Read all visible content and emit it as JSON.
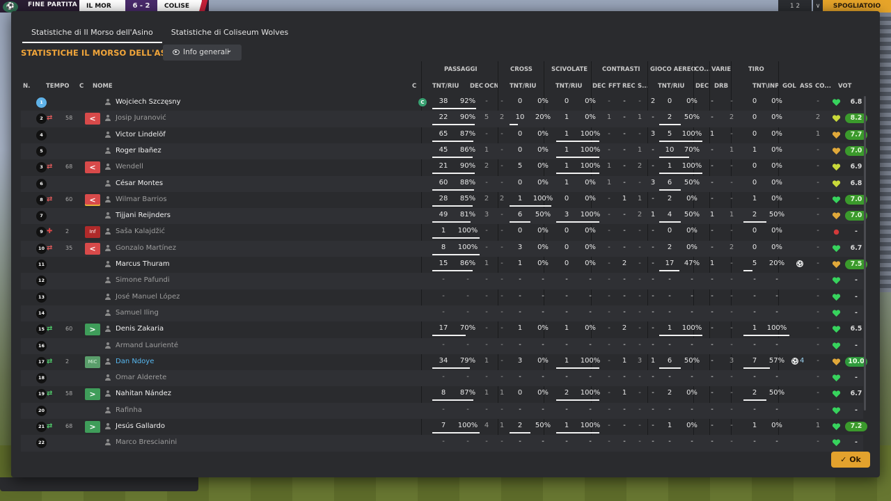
{
  "topbar": {
    "event": "FINE PARTITA",
    "team1": "IL MOR",
    "score": "6 - 2",
    "team2": "COLISE",
    "right_a": "1  2",
    "right_b": "∨",
    "right_c": "SPOGLIATOIO"
  },
  "tabs": [
    "Statistiche di Il Morso dell'Asino",
    "Statistiche di Coliseum Wolves"
  ],
  "section_title": "STATISTICHE IL MORSO DELL'ASINO",
  "dropdown_label": "Info generali",
  "groups": {
    "passaggi": "PASSAGGI",
    "cross": "CROSS",
    "scivolate": "SCIVOLATE",
    "contrasti": "CONTRASTI",
    "gioco_aereo": "GIOCO AEREO",
    "co": "CO...",
    "varie": "VARIE",
    "tiro": "TIRO"
  },
  "columns": {
    "n": "N.",
    "tempo": "TEMPO",
    "c": "C",
    "nome": "NOME",
    "c2": "C",
    "tnt_riu": "TNT/RIU",
    "dec": "DEC",
    "ocn": "OCN",
    "cross_tr": "TNT/RIU",
    "sciv_tr": "TNT/RIU",
    "con_dec": "DEC",
    "fft": "FFT",
    "rec": "REC",
    "s": "S...",
    "aereo_tr": "TNT/RIU",
    "co_dec": "DEC",
    "drb": "DRB",
    "tnt_inp": "TNT\\INP",
    "gol": "GOL",
    "ass": "ASS",
    "co2": "CO...",
    "vot": "VOT"
  },
  "rows": [
    {
      "n": "1",
      "gk": true,
      "min": "",
      "sub": "",
      "cbox": "",
      "cbox_label": "",
      "name": "Wojciech Szczęsny",
      "cap": "C",
      "dim": false,
      "blue": false,
      "pt": "38",
      "pp": "92%",
      "pbar": 0.92,
      "pdec": "-",
      "pocn": "-",
      "ct": "0",
      "cp": "0%",
      "cbar": 0,
      "st": "0",
      "sp": "0%",
      "sbar": 0,
      "kdec": "-",
      "kfft": "-",
      "krec": "-",
      "ks": "2",
      "at": "0",
      "ap": "0%",
      "abar": 0,
      "codec": "-",
      "drb": "-",
      "tt": "0",
      "tp": "0%",
      "tbar": 0,
      "gol": "",
      "ass": "-",
      "heart": "green",
      "vot": "6.8",
      "vcls": ""
    },
    {
      "n": "2",
      "gk": false,
      "min": "58",
      "sub": "out",
      "cbox": "out",
      "cbox_label": "<",
      "name": "Josip Juranović",
      "cap": "",
      "dim": true,
      "blue": false,
      "pt": "22",
      "pp": "90%",
      "pbar": 0.9,
      "pdec": "5",
      "pocn": "2",
      "ct": "10",
      "cp": "20%",
      "cbar": 0.2,
      "st": "1",
      "sp": "0%",
      "sbar": 0,
      "kdec": "1",
      "kfft": "-",
      "krec": "1",
      "ks": "-",
      "at": "2",
      "ap": "50%",
      "abar": 0.5,
      "codec": "-",
      "drb": "2",
      "tt": "0",
      "tp": "0%",
      "tbar": 0,
      "gol": "",
      "ass": "2",
      "heart": "yellow",
      "vot": "8.2",
      "vcls": "g1"
    },
    {
      "n": "4",
      "gk": false,
      "min": "",
      "sub": "",
      "cbox": "",
      "cbox_label": "",
      "name": "Victor Lindelöf",
      "cap": "",
      "dim": false,
      "blue": false,
      "pt": "65",
      "pp": "87%",
      "pbar": 0.87,
      "pdec": "-",
      "pocn": "-",
      "ct": "0",
      "cp": "0%",
      "cbar": 0,
      "st": "1",
      "sp": "100%",
      "sbar": 1,
      "kdec": "-",
      "kfft": "-",
      "krec": "-",
      "ks": "3",
      "at": "5",
      "ap": "100%",
      "abar": 1,
      "codec": "1",
      "drb": "-",
      "tt": "0",
      "tp": "0%",
      "tbar": 0,
      "gol": "",
      "ass": "1",
      "heart": "orange",
      "vot": "7.7",
      "vcls": "g1"
    },
    {
      "n": "5",
      "gk": false,
      "min": "",
      "sub": "",
      "cbox": "",
      "cbox_label": "",
      "name": "Roger Ibañez",
      "cap": "",
      "dim": false,
      "blue": false,
      "pt": "45",
      "pp": "86%",
      "pbar": 0.86,
      "pdec": "1",
      "pocn": "-",
      "ct": "0",
      "cp": "0%",
      "cbar": 0,
      "st": "1",
      "sp": "100%",
      "sbar": 1,
      "kdec": "-",
      "kfft": "-",
      "krec": "1",
      "ks": "-",
      "at": "10",
      "ap": "70%",
      "abar": 0.7,
      "codec": "-",
      "drb": "1",
      "tt": "1",
      "tp": "0%",
      "tbar": 0,
      "gol": "",
      "ass": "-",
      "heart": "orange",
      "vot": "7.0",
      "vcls": "g1"
    },
    {
      "n": "3",
      "gk": false,
      "min": "68",
      "sub": "out",
      "cbox": "out",
      "cbox_label": "<",
      "name": "Wendell",
      "cap": "",
      "dim": true,
      "blue": false,
      "pt": "21",
      "pp": "90%",
      "pbar": 0.9,
      "pdec": "2",
      "pocn": "-",
      "ct": "5",
      "cp": "0%",
      "cbar": 0,
      "st": "1",
      "sp": "100%",
      "sbar": 1,
      "kdec": "1",
      "kfft": "-",
      "krec": "2",
      "ks": "-",
      "at": "1",
      "ap": "100%",
      "abar": 1,
      "codec": "-",
      "drb": "-",
      "tt": "0",
      "tp": "0%",
      "tbar": 0,
      "gol": "",
      "ass": "-",
      "heart": "yellow",
      "vot": "6.9",
      "vcls": ""
    },
    {
      "n": "6",
      "gk": false,
      "min": "",
      "sub": "",
      "cbox": "",
      "cbox_label": "",
      "name": "César Montes",
      "cap": "",
      "dim": false,
      "blue": false,
      "pt": "60",
      "pp": "88%",
      "pbar": 0.88,
      "pdec": "-",
      "pocn": "-",
      "ct": "0",
      "cp": "0%",
      "cbar": 0,
      "st": "1",
      "sp": "0%",
      "sbar": 0,
      "kdec": "1",
      "kfft": "-",
      "krec": "-",
      "ks": "3",
      "at": "6",
      "ap": "50%",
      "abar": 0.5,
      "codec": "-",
      "drb": "-",
      "tt": "0",
      "tp": "0%",
      "tbar": 0,
      "gol": "",
      "ass": "-",
      "heart": "yellow",
      "vot": "6.8",
      "vcls": ""
    },
    {
      "n": "8",
      "gk": false,
      "min": "60",
      "sub": "out",
      "cbox": "outy",
      "cbox_label": "<",
      "name": "Wilmar Barrios",
      "cap": "",
      "dim": true,
      "blue": false,
      "pt": "28",
      "pp": "85%",
      "pbar": 0.85,
      "pdec": "2",
      "pocn": "2",
      "ct": "1",
      "cp": "100%",
      "cbar": 1,
      "st": "0",
      "sp": "0%",
      "sbar": 0,
      "kdec": "-",
      "kfft": "1",
      "krec": "1",
      "ks": "-",
      "at": "2",
      "ap": "0%",
      "abar": 0,
      "codec": "-",
      "drb": "-",
      "tt": "1",
      "tp": "0%",
      "tbar": 0,
      "gol": "",
      "ass": "-",
      "heart": "green",
      "vot": "7.0",
      "vcls": "g1"
    },
    {
      "n": "7",
      "gk": false,
      "min": "",
      "sub": "",
      "cbox": "",
      "cbox_label": "",
      "name": "Tijjani Reijnders",
      "cap": "",
      "dim": false,
      "blue": false,
      "pt": "49",
      "pp": "81%",
      "pbar": 0.81,
      "pdec": "3",
      "pocn": "-",
      "ct": "6",
      "cp": "50%",
      "cbar": 0.5,
      "st": "3",
      "sp": "100%",
      "sbar": 1,
      "kdec": "-",
      "kfft": "-",
      "krec": "2",
      "ks": "1",
      "at": "4",
      "ap": "50%",
      "abar": 0.5,
      "codec": "1",
      "drb": "1",
      "tt": "2",
      "tp": "50%",
      "tbar": 0.5,
      "gol": "",
      "ass": "-",
      "heart": "orange",
      "vot": "7.0",
      "vcls": "g1"
    },
    {
      "n": "9",
      "gk": false,
      "min": "2",
      "sub": "inj",
      "cbox": "inj",
      "cbox_label": "Inf",
      "name": "Saša Kalajdžić",
      "cap": "",
      "dim": true,
      "blue": false,
      "pt": "1",
      "pp": "100%",
      "pbar": 1,
      "pdec": "-",
      "pocn": "-",
      "ct": "0",
      "cp": "0%",
      "cbar": 0,
      "st": "0",
      "sp": "0%",
      "sbar": 0,
      "kdec": "-",
      "kfft": "-",
      "krec": "-",
      "ks": "-",
      "at": "0",
      "ap": "0%",
      "abar": 0,
      "codec": "-",
      "drb": "-",
      "tt": "0",
      "tp": "0%",
      "tbar": 0,
      "gol": "",
      "ass": "-",
      "heart": "red",
      "vot": "-",
      "vcls": ""
    },
    {
      "n": "10",
      "gk": false,
      "min": "35",
      "sub": "out",
      "cbox": "out",
      "cbox_label": "<",
      "name": "Gonzalo Martínez",
      "cap": "",
      "dim": true,
      "blue": false,
      "pt": "8",
      "pp": "100%",
      "pbar": 1,
      "pdec": "-",
      "pocn": "-",
      "ct": "3",
      "cp": "0%",
      "cbar": 0,
      "st": "0",
      "sp": "0%",
      "sbar": 0,
      "kdec": "-",
      "kfft": "-",
      "krec": "-",
      "ks": "-",
      "at": "2",
      "ap": "0%",
      "abar": 0,
      "codec": "-",
      "drb": "2",
      "tt": "0",
      "tp": "0%",
      "tbar": 0,
      "gol": "",
      "ass": "-",
      "heart": "green",
      "vot": "6.7",
      "vcls": ""
    },
    {
      "n": "11",
      "gk": false,
      "min": "",
      "sub": "",
      "cbox": "",
      "cbox_label": "",
      "name": "Marcus Thuram",
      "cap": "",
      "dim": false,
      "blue": false,
      "pt": "15",
      "pp": "86%",
      "pbar": 0.86,
      "pdec": "1",
      "pocn": "-",
      "ct": "1",
      "cp": "0%",
      "cbar": 0,
      "st": "0",
      "sp": "0%",
      "sbar": 0,
      "kdec": "-",
      "kfft": "2",
      "krec": "-",
      "ks": "-",
      "at": "17",
      "ap": "47%",
      "abar": 0.47,
      "codec": "1",
      "drb": "-",
      "tt": "5",
      "tp": "20%",
      "tbar": 0.2,
      "gol": "ball",
      "ass": "-",
      "heart": "orange",
      "vot": "7.5",
      "vcls": "g1"
    },
    {
      "n": "12",
      "gk": false,
      "min": "",
      "sub": "",
      "cbox": "",
      "cbox_label": "",
      "name": "Simone Pafundi",
      "cap": "",
      "dim": true,
      "blue": false,
      "pt": "-",
      "pp": "-",
      "pbar": 0,
      "pdec": "-",
      "pocn": "-",
      "ct": "-",
      "cp": "-",
      "cbar": 0,
      "st": "-",
      "sp": "-",
      "sbar": 0,
      "kdec": "-",
      "kfft": "-",
      "krec": "-",
      "ks": "-",
      "at": "-",
      "ap": "-",
      "abar": 0,
      "codec": "-",
      "drb": "-",
      "tt": "-",
      "tp": "-",
      "tbar": 0,
      "gol": "",
      "ass": "-",
      "heart": "green",
      "vot": "-",
      "vcls": ""
    },
    {
      "n": "13",
      "gk": false,
      "min": "",
      "sub": "",
      "cbox": "",
      "cbox_label": "",
      "name": "José Manuel López",
      "cap": "",
      "dim": true,
      "blue": false,
      "pt": "-",
      "pp": "-",
      "pbar": 0,
      "pdec": "-",
      "pocn": "-",
      "ct": "-",
      "cp": "-",
      "cbar": 0,
      "st": "-",
      "sp": "-",
      "sbar": 0,
      "kdec": "-",
      "kfft": "-",
      "krec": "-",
      "ks": "-",
      "at": "-",
      "ap": "-",
      "abar": 0,
      "codec": "-",
      "drb": "-",
      "tt": "-",
      "tp": "-",
      "tbar": 0,
      "gol": "",
      "ass": "-",
      "heart": "green",
      "vot": "-",
      "vcls": ""
    },
    {
      "n": "14",
      "gk": false,
      "min": "",
      "sub": "",
      "cbox": "",
      "cbox_label": "",
      "name": "Samuel Iling",
      "cap": "",
      "dim": true,
      "blue": false,
      "pt": "-",
      "pp": "-",
      "pbar": 0,
      "pdec": "-",
      "pocn": "-",
      "ct": "-",
      "cp": "-",
      "cbar": 0,
      "st": "-",
      "sp": "-",
      "sbar": 0,
      "kdec": "-",
      "kfft": "-",
      "krec": "-",
      "ks": "-",
      "at": "-",
      "ap": "-",
      "abar": 0,
      "codec": "-",
      "drb": "-",
      "tt": "-",
      "tp": "-",
      "tbar": 0,
      "gol": "",
      "ass": "-",
      "heart": "green",
      "vot": "-",
      "vcls": ""
    },
    {
      "n": "15",
      "gk": false,
      "min": "60",
      "sub": "in",
      "cbox": "in",
      "cbox_label": ">",
      "name": "Denis Zakaria",
      "cap": "",
      "dim": false,
      "blue": false,
      "pt": "17",
      "pp": "70%",
      "pbar": 0.7,
      "pdec": "-",
      "pocn": "-",
      "ct": "1",
      "cp": "0%",
      "cbar": 0,
      "st": "1",
      "sp": "0%",
      "sbar": 0,
      "kdec": "-",
      "kfft": "2",
      "krec": "-",
      "ks": "-",
      "at": "1",
      "ap": "100%",
      "abar": 1,
      "codec": "-",
      "drb": "-",
      "tt": "1",
      "tp": "100%",
      "tbar": 1,
      "gol": "",
      "ass": "-",
      "heart": "green",
      "vot": "6.5",
      "vcls": ""
    },
    {
      "n": "16",
      "gk": false,
      "min": "",
      "sub": "",
      "cbox": "",
      "cbox_label": "",
      "name": "Armand Laurienté",
      "cap": "",
      "dim": true,
      "blue": false,
      "pt": "-",
      "pp": "-",
      "pbar": 0,
      "pdec": "-",
      "pocn": "-",
      "ct": "-",
      "cp": "-",
      "cbar": 0,
      "st": "-",
      "sp": "-",
      "sbar": 0,
      "kdec": "-",
      "kfft": "-",
      "krec": "-",
      "ks": "-",
      "at": "-",
      "ap": "-",
      "abar": 0,
      "codec": "-",
      "drb": "-",
      "tt": "-",
      "tp": "-",
      "tbar": 0,
      "gol": "",
      "ass": "-",
      "heart": "green",
      "vot": "-",
      "vcls": ""
    },
    {
      "n": "17",
      "gk": false,
      "min": "2",
      "sub": "in",
      "cbox": "mic",
      "cbox_label": "MiC",
      "name": "Dan Ndoye",
      "cap": "",
      "dim": false,
      "blue": true,
      "pt": "34",
      "pp": "79%",
      "pbar": 0.79,
      "pdec": "1",
      "pocn": "-",
      "ct": "3",
      "cp": "0%",
      "cbar": 0,
      "st": "1",
      "sp": "100%",
      "sbar": 1,
      "kdec": "-",
      "kfft": "1",
      "krec": "3",
      "ks": "1",
      "at": "6",
      "ap": "50%",
      "abar": 0.5,
      "codec": "-",
      "drb": "3",
      "tt": "7",
      "tp": "57%",
      "tbar": 0.57,
      "gol": "ball4",
      "ass": "-",
      "heart": "orange",
      "vot": "10.0",
      "vcls": "g2"
    },
    {
      "n": "18",
      "gk": false,
      "min": "",
      "sub": "",
      "cbox": "",
      "cbox_label": "",
      "name": "Omar Alderete",
      "cap": "",
      "dim": true,
      "blue": false,
      "pt": "-",
      "pp": "-",
      "pbar": 0,
      "pdec": "-",
      "pocn": "-",
      "ct": "-",
      "cp": "-",
      "cbar": 0,
      "st": "-",
      "sp": "-",
      "sbar": 0,
      "kdec": "-",
      "kfft": "-",
      "krec": "-",
      "ks": "-",
      "at": "-",
      "ap": "-",
      "abar": 0,
      "codec": "-",
      "drb": "-",
      "tt": "-",
      "tp": "-",
      "tbar": 0,
      "gol": "",
      "ass": "-",
      "heart": "green",
      "vot": "-",
      "vcls": ""
    },
    {
      "n": "19",
      "gk": false,
      "min": "58",
      "sub": "in",
      "cbox": "in",
      "cbox_label": ">",
      "name": "Nahitan Nández",
      "cap": "",
      "dim": false,
      "blue": false,
      "pt": "8",
      "pp": "87%",
      "pbar": 0.87,
      "pdec": "1",
      "pocn": "1",
      "ct": "0",
      "cp": "0%",
      "cbar": 0,
      "st": "2",
      "sp": "100%",
      "sbar": 1,
      "kdec": "-",
      "kfft": "1",
      "krec": "-",
      "ks": "-",
      "at": "2",
      "ap": "0%",
      "abar": 0,
      "codec": "-",
      "drb": "-",
      "tt": "2",
      "tp": "50%",
      "tbar": 0.5,
      "gol": "",
      "ass": "-",
      "heart": "green",
      "vot": "6.7",
      "vcls": ""
    },
    {
      "n": "20",
      "gk": false,
      "min": "",
      "sub": "",
      "cbox": "",
      "cbox_label": "",
      "name": "Rafinha",
      "cap": "",
      "dim": true,
      "blue": false,
      "pt": "-",
      "pp": "-",
      "pbar": 0,
      "pdec": "-",
      "pocn": "-",
      "ct": "-",
      "cp": "-",
      "cbar": 0,
      "st": "-",
      "sp": "-",
      "sbar": 0,
      "kdec": "-",
      "kfft": "-",
      "krec": "-",
      "ks": "-",
      "at": "-",
      "ap": "-",
      "abar": 0,
      "codec": "-",
      "drb": "-",
      "tt": "-",
      "tp": "-",
      "tbar": 0,
      "gol": "",
      "ass": "-",
      "heart": "green",
      "vot": "-",
      "vcls": ""
    },
    {
      "n": "21",
      "gk": false,
      "min": "68",
      "sub": "in",
      "cbox": "in",
      "cbox_label": ">",
      "name": "Jesús Gallardo",
      "cap": "",
      "dim": false,
      "blue": false,
      "pt": "7",
      "pp": "100%",
      "pbar": 1,
      "pdec": "4",
      "pocn": "1",
      "ct": "2",
      "cp": "50%",
      "cbar": 0.5,
      "st": "1",
      "sp": "100%",
      "sbar": 1,
      "kdec": "-",
      "kfft": "-",
      "krec": "-",
      "ks": "-",
      "at": "1",
      "ap": "0%",
      "abar": 0,
      "codec": "-",
      "drb": "-",
      "tt": "1",
      "tp": "0%",
      "tbar": 0,
      "gol": "",
      "ass": "1",
      "heart": "green",
      "vot": "7.2",
      "vcls": "g1"
    },
    {
      "n": "22",
      "gk": false,
      "min": "",
      "sub": "",
      "cbox": "",
      "cbox_label": "",
      "name": "Marco Brescianini",
      "cap": "",
      "dim": true,
      "blue": false,
      "pt": "-",
      "pp": "-",
      "pbar": 0,
      "pdec": "-",
      "pocn": "-",
      "ct": "-",
      "cp": "-",
      "cbar": 0,
      "st": "-",
      "sp": "-",
      "sbar": 0,
      "kdec": "-",
      "kfft": "-",
      "krec": "-",
      "ks": "-",
      "at": "-",
      "ap": "-",
      "abar": 0,
      "codec": "-",
      "drb": "-",
      "tt": "-",
      "tp": "-",
      "tbar": 0,
      "gol": "",
      "ass": "-",
      "heart": "green",
      "vot": "-",
      "vcls": ""
    }
  ],
  "ok_label": "Ok",
  "colors": {
    "accent": "#f2a63a",
    "ok": "#e3a22d",
    "heart_green": "#37d35d",
    "heart_yellow": "#c9d93a",
    "heart_orange": "#e0a83a",
    "heart_red": "#d23a3a"
  }
}
